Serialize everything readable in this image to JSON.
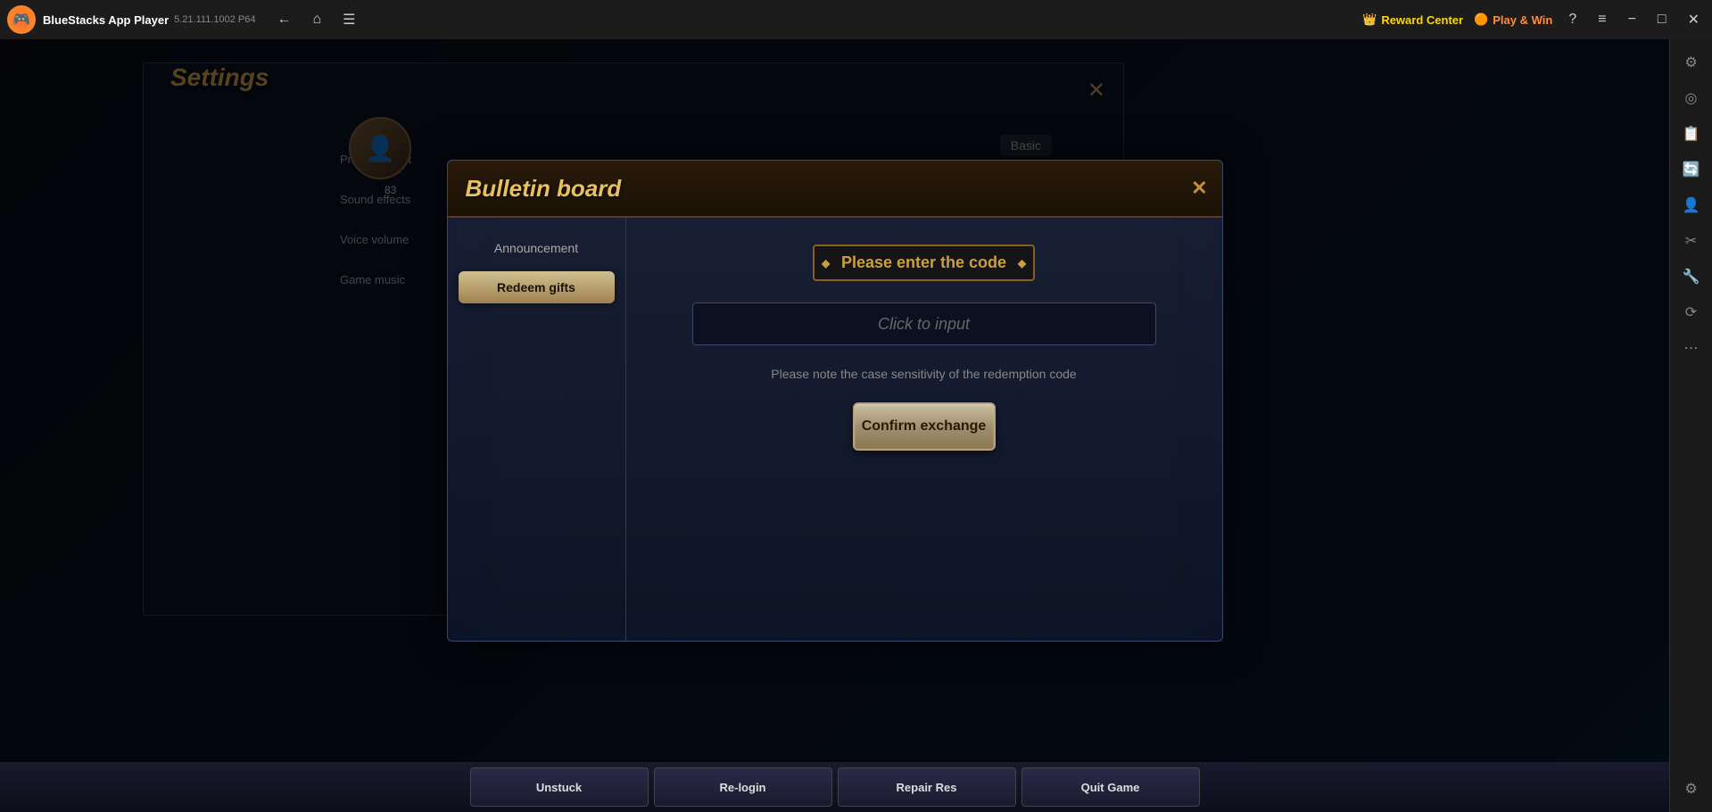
{
  "titlebar": {
    "app_name": "BlueStacks App Player",
    "version": "5.21.111.1002  P64",
    "nav": {
      "back_label": "←",
      "home_label": "⌂",
      "bookmark_label": "☰"
    },
    "reward_center": "Reward Center",
    "play_win": "Play & Win",
    "icons": {
      "help": "?",
      "menu": "≡",
      "minimize": "−",
      "maximize": "□",
      "close": "✕"
    }
  },
  "bulletin": {
    "title": "Bulletin board",
    "close_label": "✕",
    "sidebar": {
      "items": [
        {
          "label": "Announcement",
          "active": false
        },
        {
          "label": "Redeem gifts",
          "active": true
        }
      ]
    },
    "content": {
      "code_label": "Please enter the code",
      "input_placeholder": "Click to input",
      "note_text": "Please note the case sensitivity of the redemption code",
      "confirm_label": "Confirm exchange"
    }
  },
  "settings": {
    "title": "Settings",
    "close_label": "✕",
    "sidebar_items": [
      "Priority Target",
      "Sound effects",
      "Voice volume",
      "Game music"
    ],
    "right_label": "Basic"
  },
  "bottom_bar": {
    "buttons": [
      "Unstuck",
      "Re-login",
      "Repair Res",
      "Quit Game"
    ]
  },
  "right_panel": {
    "icons": [
      "⚙",
      "◎",
      "📋",
      "🔄",
      "👤",
      "✂",
      "🔧",
      "⟳",
      "⋯",
      "⚙"
    ]
  }
}
